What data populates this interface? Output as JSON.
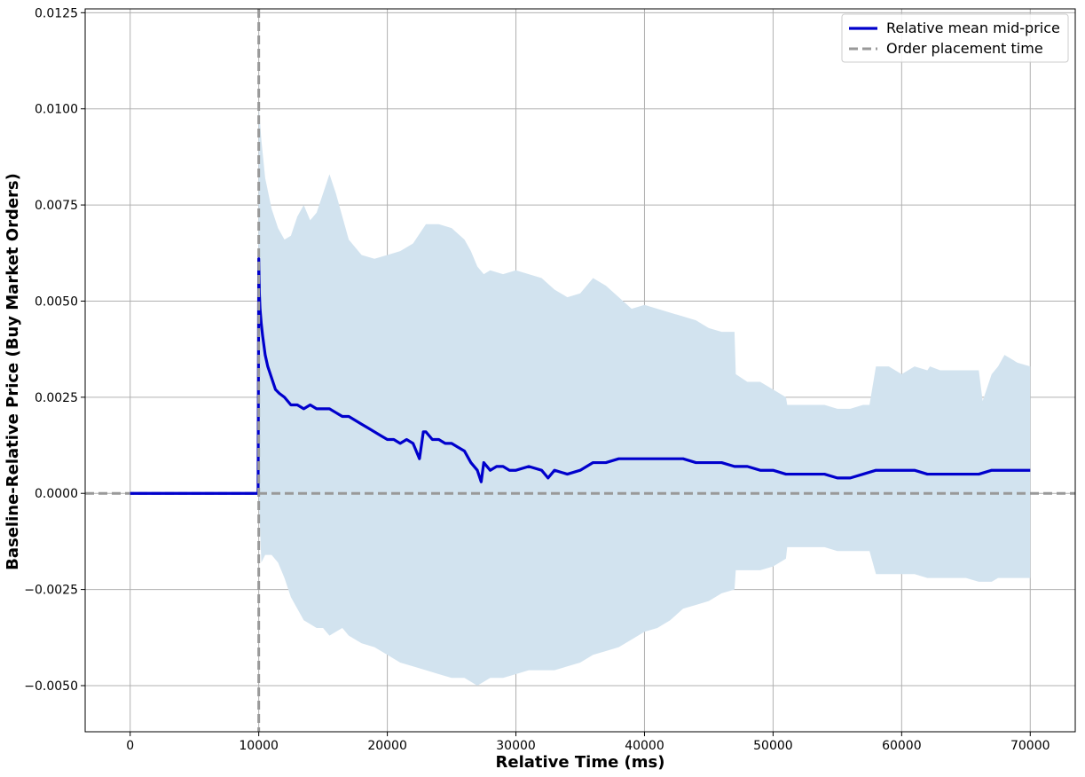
{
  "chart_data": {
    "type": "line",
    "title": "",
    "xlabel": "Relative Time (ms)",
    "ylabel": "Baseline-Relative Price (Buy Market Orders)",
    "xlim": [
      -3500,
      73500
    ],
    "ylim": [
      -0.0062,
      0.0126
    ],
    "xticks": [
      0,
      10000,
      20000,
      30000,
      40000,
      50000,
      60000,
      70000
    ],
    "xtick_labels": [
      "0",
      "10000",
      "20000",
      "30000",
      "40000",
      "50000",
      "60000",
      "70000"
    ],
    "yticks": [
      -0.005,
      -0.0025,
      0.0,
      0.0025,
      0.005,
      0.0075,
      0.01,
      0.0125
    ],
    "ytick_labels": [
      "−0.0050",
      "−0.0025",
      "0.0000",
      "0.0025",
      "0.0050",
      "0.0075",
      "0.0100",
      "0.0125"
    ],
    "grid": true,
    "legend_position": "top-right",
    "legend": [
      "Relative mean mid-price",
      "Order placement time"
    ],
    "colors": {
      "mean": "#0000cc",
      "band": "#d2e3ef",
      "reference": "#999999",
      "grid": "#b0b0b0"
    },
    "series": [
      {
        "name": "Relative mean mid-price",
        "x": [
          0,
          9950,
          10000,
          10050,
          10100,
          10200,
          10300,
          10500,
          10700,
          11000,
          11300,
          11600,
          12000,
          12500,
          13000,
          13500,
          14000,
          14500,
          15000,
          15500,
          16000,
          16500,
          17000,
          17500,
          18000,
          18500,
          19000,
          19500,
          20000,
          20500,
          21000,
          21500,
          22000,
          22500,
          22800,
          23000,
          23500,
          24000,
          24500,
          25000,
          25500,
          26000,
          26500,
          27000,
          27300,
          27500,
          28000,
          28500,
          29000,
          29500,
          30000,
          31000,
          32000,
          32500,
          33000,
          34000,
          35000,
          36000,
          37000,
          38000,
          39000,
          40000,
          41000,
          42000,
          43000,
          44000,
          45000,
          46000,
          47000,
          48000,
          49000,
          50000,
          51000,
          52000,
          53000,
          54000,
          55000,
          56000,
          57000,
          58000,
          59000,
          60000,
          61000,
          62000,
          63000,
          64000,
          65000,
          66000,
          67000,
          68000,
          69000,
          70000
        ],
        "y": [
          0.0,
          0.0,
          0.0061,
          0.0052,
          0.0048,
          0.0044,
          0.0041,
          0.0036,
          0.0033,
          0.003,
          0.0027,
          0.0026,
          0.0025,
          0.0023,
          0.0023,
          0.0022,
          0.0023,
          0.0022,
          0.0022,
          0.0022,
          0.0021,
          0.002,
          0.002,
          0.0019,
          0.0018,
          0.0017,
          0.0016,
          0.0015,
          0.0014,
          0.0014,
          0.0013,
          0.0014,
          0.0013,
          0.0009,
          0.0016,
          0.0016,
          0.0014,
          0.0014,
          0.0013,
          0.0013,
          0.0012,
          0.0011,
          0.0008,
          0.0006,
          0.0003,
          0.0008,
          0.0006,
          0.0007,
          0.0007,
          0.0006,
          0.0006,
          0.0007,
          0.0006,
          0.0004,
          0.0006,
          0.0005,
          0.0006,
          0.0008,
          0.0008,
          0.0009,
          0.0009,
          0.0009,
          0.0009,
          0.0009,
          0.0009,
          0.0008,
          0.0008,
          0.0008,
          0.0007,
          0.0007,
          0.0006,
          0.0006,
          0.0005,
          0.0005,
          0.0005,
          0.0005,
          0.0004,
          0.0004,
          0.0005,
          0.0006,
          0.0006,
          0.0006,
          0.0006,
          0.0005,
          0.0005,
          0.0005,
          0.0005,
          0.0005,
          0.0006,
          0.0006,
          0.0006,
          0.0006
        ]
      }
    ],
    "band": {
      "x": [
        0,
        9950,
        10000,
        10200,
        10500,
        11000,
        11500,
        12000,
        12500,
        13000,
        13500,
        14000,
        14500,
        15000,
        15500,
        16000,
        16500,
        17000,
        18000,
        19000,
        20000,
        21000,
        22000,
        23000,
        24000,
        25000,
        26000,
        26500,
        27000,
        27500,
        28000,
        29000,
        30000,
        31000,
        32000,
        33000,
        34000,
        35000,
        36000,
        37000,
        38000,
        39000,
        40000,
        41000,
        42000,
        43000,
        44000,
        45000,
        46000,
        47000,
        47100,
        48000,
        49000,
        50000,
        51000,
        51100,
        52000,
        53000,
        54000,
        55000,
        56000,
        57000,
        57500,
        58000,
        59000,
        60000,
        61000,
        62000,
        62200,
        63000,
        64000,
        65000,
        66000,
        66300,
        67000,
        67500,
        68000,
        69000,
        70000
      ],
      "upper": [
        0.0,
        0.0,
        0.0101,
        0.0092,
        0.0082,
        0.0074,
        0.0069,
        0.0066,
        0.0067,
        0.0072,
        0.0075,
        0.0071,
        0.0073,
        0.0078,
        0.0083,
        0.0078,
        0.0072,
        0.0066,
        0.0062,
        0.0061,
        0.0062,
        0.0063,
        0.0065,
        0.007,
        0.007,
        0.0069,
        0.0066,
        0.0063,
        0.0059,
        0.0057,
        0.0058,
        0.0057,
        0.0058,
        0.0057,
        0.0056,
        0.0053,
        0.0051,
        0.0052,
        0.0056,
        0.0054,
        0.0051,
        0.0048,
        0.0049,
        0.0048,
        0.0047,
        0.0046,
        0.0045,
        0.0043,
        0.0042,
        0.0042,
        0.0031,
        0.0029,
        0.0029,
        0.0027,
        0.0025,
        0.0023,
        0.0023,
        0.0023,
        0.0023,
        0.0022,
        0.0022,
        0.0023,
        0.0023,
        0.0033,
        0.0033,
        0.0031,
        0.0033,
        0.0032,
        0.0033,
        0.0032,
        0.0032,
        0.0032,
        0.0032,
        0.0024,
        0.0031,
        0.0033,
        0.0036,
        0.0034,
        0.0033
      ],
      "lower": [
        0.0,
        0.0,
        0.0,
        -0.0018,
        -0.0016,
        -0.0016,
        -0.0018,
        -0.0022,
        -0.0027,
        -0.003,
        -0.0033,
        -0.0034,
        -0.0035,
        -0.0035,
        -0.0037,
        -0.0036,
        -0.0035,
        -0.0037,
        -0.0039,
        -0.004,
        -0.0042,
        -0.0044,
        -0.0045,
        -0.0046,
        -0.0047,
        -0.0048,
        -0.0048,
        -0.0049,
        -0.005,
        -0.0049,
        -0.0048,
        -0.0048,
        -0.0047,
        -0.0046,
        -0.0046,
        -0.0046,
        -0.0045,
        -0.0044,
        -0.0042,
        -0.0041,
        -0.004,
        -0.0038,
        -0.0036,
        -0.0035,
        -0.0033,
        -0.003,
        -0.0029,
        -0.0028,
        -0.0026,
        -0.0025,
        -0.002,
        -0.002,
        -0.002,
        -0.0019,
        -0.0017,
        -0.0014,
        -0.0014,
        -0.0014,
        -0.0014,
        -0.0015,
        -0.0015,
        -0.0015,
        -0.0015,
        -0.0021,
        -0.0021,
        -0.0021,
        -0.0021,
        -0.0022,
        -0.0022,
        -0.0022,
        -0.0022,
        -0.0022,
        -0.0023,
        -0.0023,
        -0.0023,
        -0.0022,
        -0.0022,
        -0.0022,
        -0.0022
      ]
    },
    "reference_lines": [
      {
        "type": "vertical",
        "x": 10000
      },
      {
        "type": "horizontal",
        "y": 0
      }
    ]
  }
}
